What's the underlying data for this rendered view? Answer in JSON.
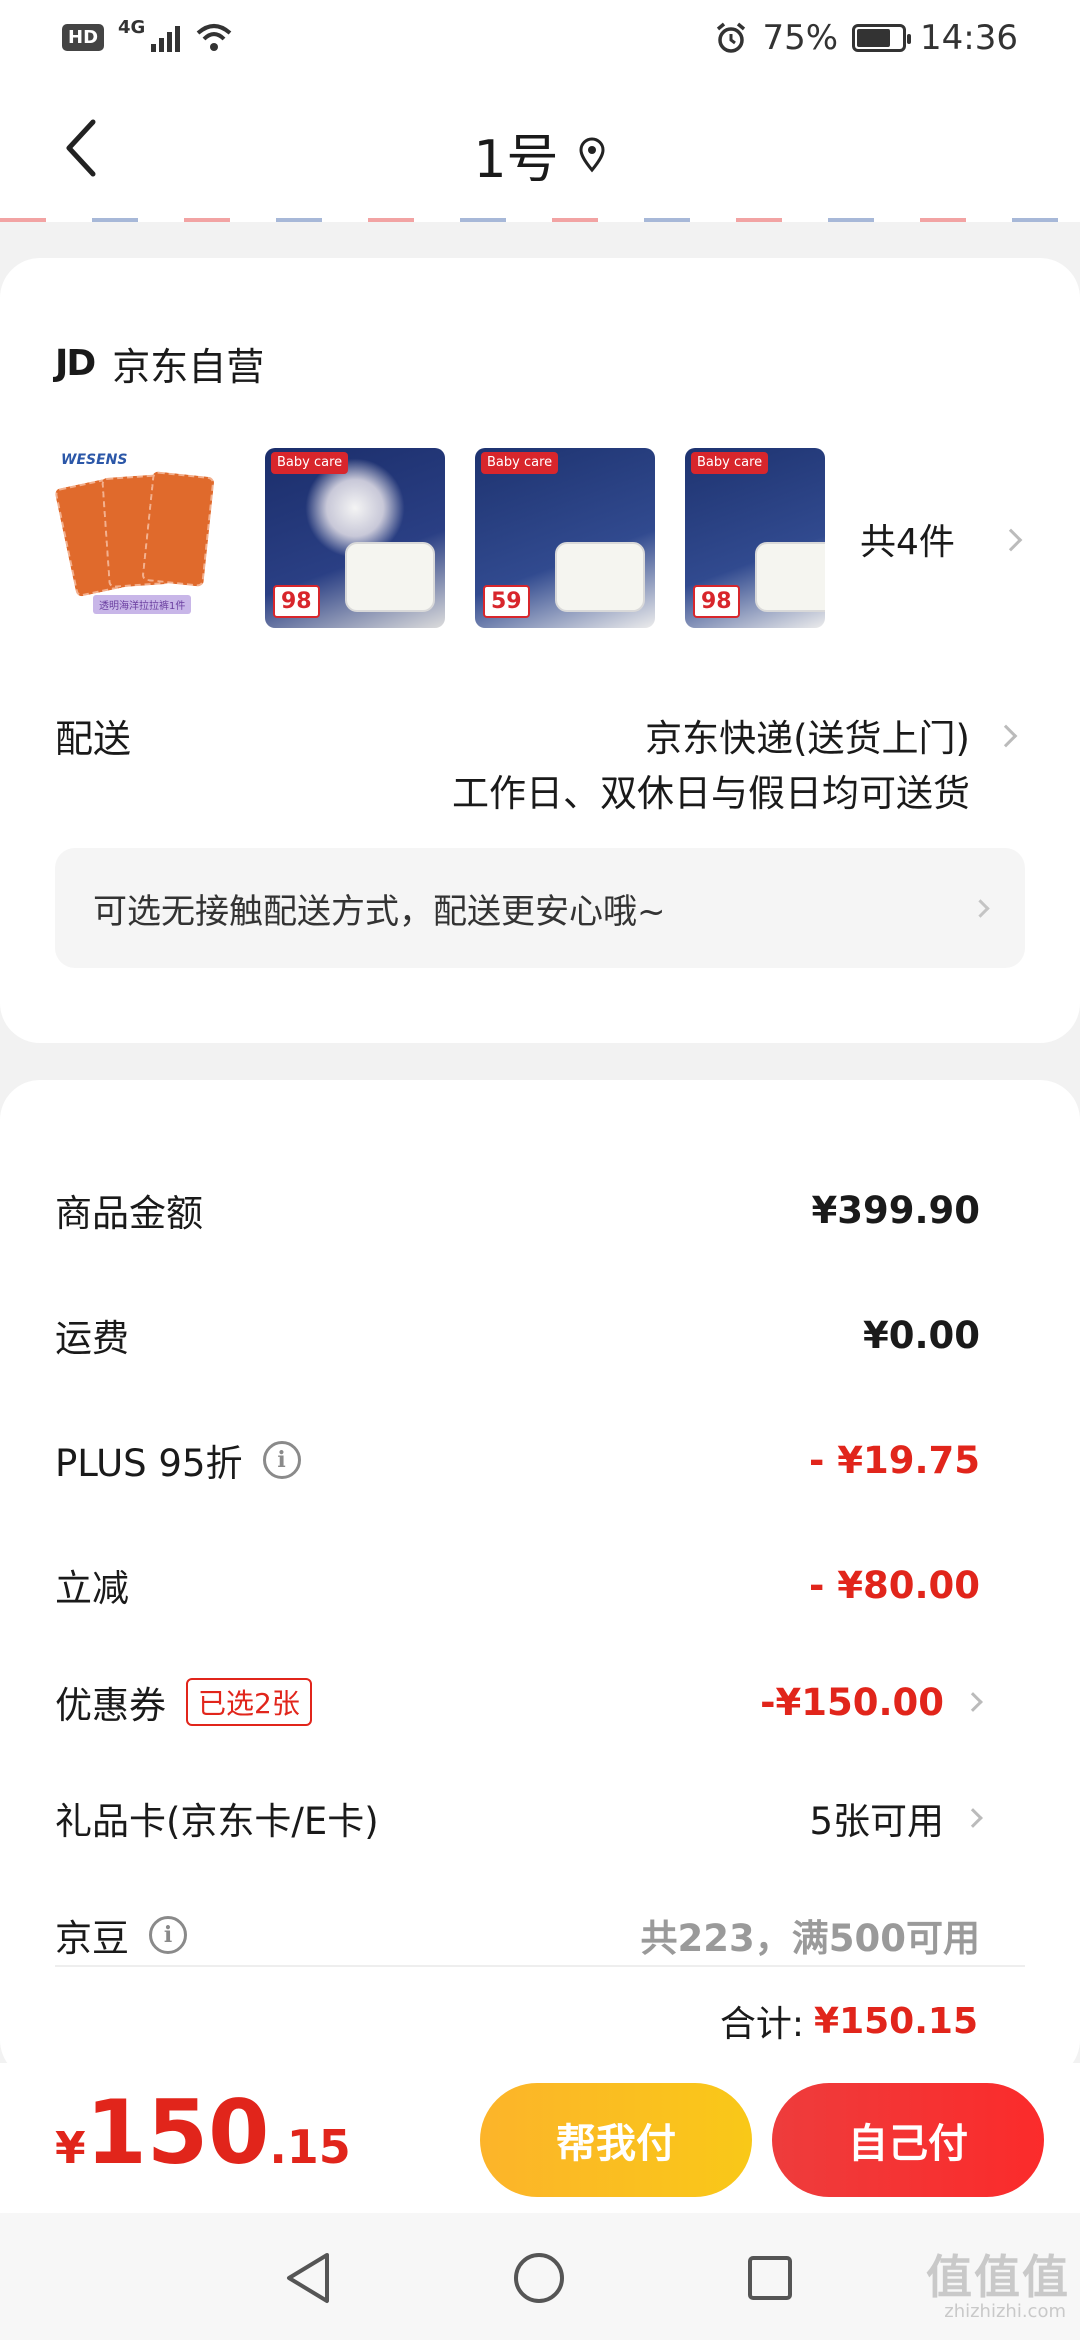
{
  "status_bar": {
    "hd": "HD",
    "network": "4G",
    "battery_pct": "75%",
    "time": "14:36"
  },
  "header": {
    "title": "1号"
  },
  "store": {
    "logo": "JD",
    "name": "京东自营"
  },
  "products": {
    "item1_brand": "WESENS",
    "item1_label": "透明海洋拉拉裤1件",
    "item2_tag": "Baby care",
    "item2_price": "98",
    "item3_tag": "Baby care",
    "item3_price": "59",
    "item4_tag": "Baby care",
    "item4_price": "98",
    "count": "共4件"
  },
  "delivery": {
    "label": "配送",
    "method": "京东快递(送货上门)",
    "schedule": "工作日、双休日与假日均可送货",
    "contactless": "可选无接触配送方式，配送更安心哦~"
  },
  "summary": {
    "goods_label": "商品金额",
    "goods_value": "¥399.90",
    "freight_label": "运费",
    "freight_value": "¥0.00",
    "plus_label": "PLUS 95折",
    "plus_value": "- ¥19.75",
    "instant_label": "立减",
    "instant_value": "- ¥80.00",
    "coupon_label": "优惠券",
    "coupon_badge": "已选2张",
    "coupon_value": "-¥150.00",
    "giftcard_label": "礼品卡(京东卡/E卡)",
    "giftcard_value": "5张可用",
    "beans_label": "京豆",
    "beans_value": "共223，满500可用",
    "total_label": "合计:",
    "total_value": "¥150.15"
  },
  "footer": {
    "currency": "¥",
    "price_int": "150",
    "price_dec": ".15",
    "help_pay": "帮我付",
    "self_pay": "自己付"
  },
  "watermark": {
    "text": "值值值",
    "domain": "zhizhizhi.com"
  },
  "colors": {
    "accent_red": "#e1251b",
    "help_yellow": "#fcb42a",
    "page_bg": "#f2f2f2"
  }
}
